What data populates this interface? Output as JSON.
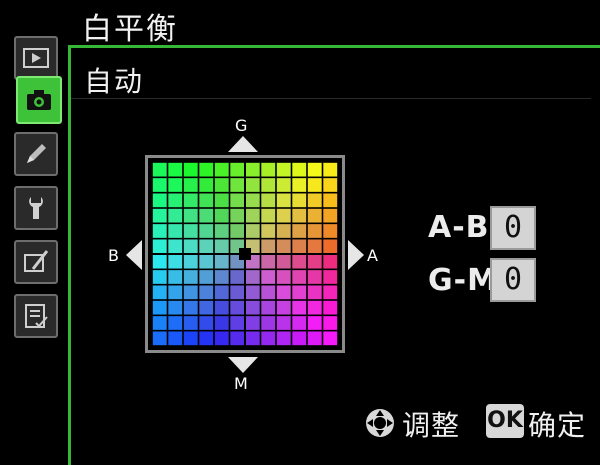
{
  "header": {
    "title": "白平衡"
  },
  "sidebar": {
    "tabs": [
      {
        "icon": "playback-icon",
        "active": false
      },
      {
        "icon": "camera-icon",
        "active": true
      },
      {
        "icon": "pencil-icon",
        "active": false
      },
      {
        "icon": "wrench-icon",
        "active": false
      },
      {
        "icon": "retouch-brush-icon",
        "active": false
      },
      {
        "icon": "my-menu-icon",
        "active": false
      }
    ]
  },
  "panel": {
    "title": "自动"
  },
  "grid": {
    "rows": 12,
    "cols": 12,
    "cursor": {
      "a_b": 0,
      "g_m": 0
    },
    "labels": {
      "top": "G",
      "bottom": "M",
      "left": "B",
      "right": "A"
    }
  },
  "readouts": [
    {
      "label": "A-B",
      "value": "0"
    },
    {
      "label": "G-M",
      "value": "0"
    }
  ],
  "footer": {
    "adjust_label": "调整",
    "ok_label": "OK",
    "confirm_label": "确定"
  },
  "colors": {
    "accent": "#3ec23a",
    "frame": "#36b836"
  }
}
